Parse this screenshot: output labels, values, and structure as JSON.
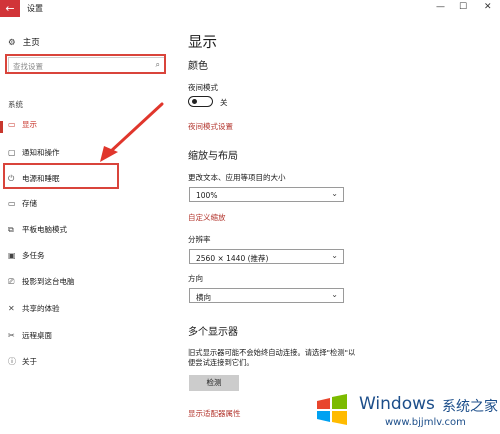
{
  "window": {
    "title": "设置",
    "back_icon": "←",
    "minimize_icon": "—",
    "maximize_icon": "☐",
    "close_icon": "✕"
  },
  "sidebar": {
    "home_icon": "⚙",
    "home_label": "主页",
    "search_placeholder": "查找设置",
    "search_icon": "⌕",
    "section_label": "系统",
    "items": [
      {
        "icon": "▭",
        "label": "显示"
      },
      {
        "icon": "▢",
        "label": "通知和操作"
      },
      {
        "icon": "⏻",
        "label": "电源和睡眠"
      },
      {
        "icon": "▭",
        "label": "存储"
      },
      {
        "icon": "⧉",
        "label": "平板电脑模式"
      },
      {
        "icon": "▣",
        "label": "多任务"
      },
      {
        "icon": "⎚",
        "label": "投影到这台电脑"
      },
      {
        "icon": "✕",
        "label": "共享的体验"
      },
      {
        "icon": "✂",
        "label": "远程桌面"
      },
      {
        "icon": "ⓘ",
        "label": "关于"
      }
    ]
  },
  "main": {
    "page_title": "显示",
    "color_heading": "颜色",
    "night_mode_label": "夜间模式",
    "night_mode_state": "关",
    "night_mode_link": "夜间模式设置",
    "scale_heading": "缩放与布局",
    "scale_label": "更改文本、应用等项目的大小",
    "scale_value": "100%",
    "custom_scale_link": "自定义缩放",
    "resolution_label": "分辨率",
    "resolution_value": "2560 × 1440 (推荐)",
    "orientation_label": "方向",
    "orientation_value": "横向",
    "multi_display_heading": "多个显示器",
    "multi_display_desc": "旧式显示器可能不会始终自动连接。请选择\"检测\"以便尝试连接到它们。",
    "detect_button": "检测",
    "adapter_link": "显示适配器属性",
    "chevron": "⌄"
  },
  "watermark": {
    "brand": "Windows",
    "brand_cn": "系统之家",
    "url": "www.bjjmlv.com"
  },
  "colors": {
    "accent": "#c8372d",
    "highlight": "#d9443b",
    "wm_blue": "#1c4e8a"
  }
}
